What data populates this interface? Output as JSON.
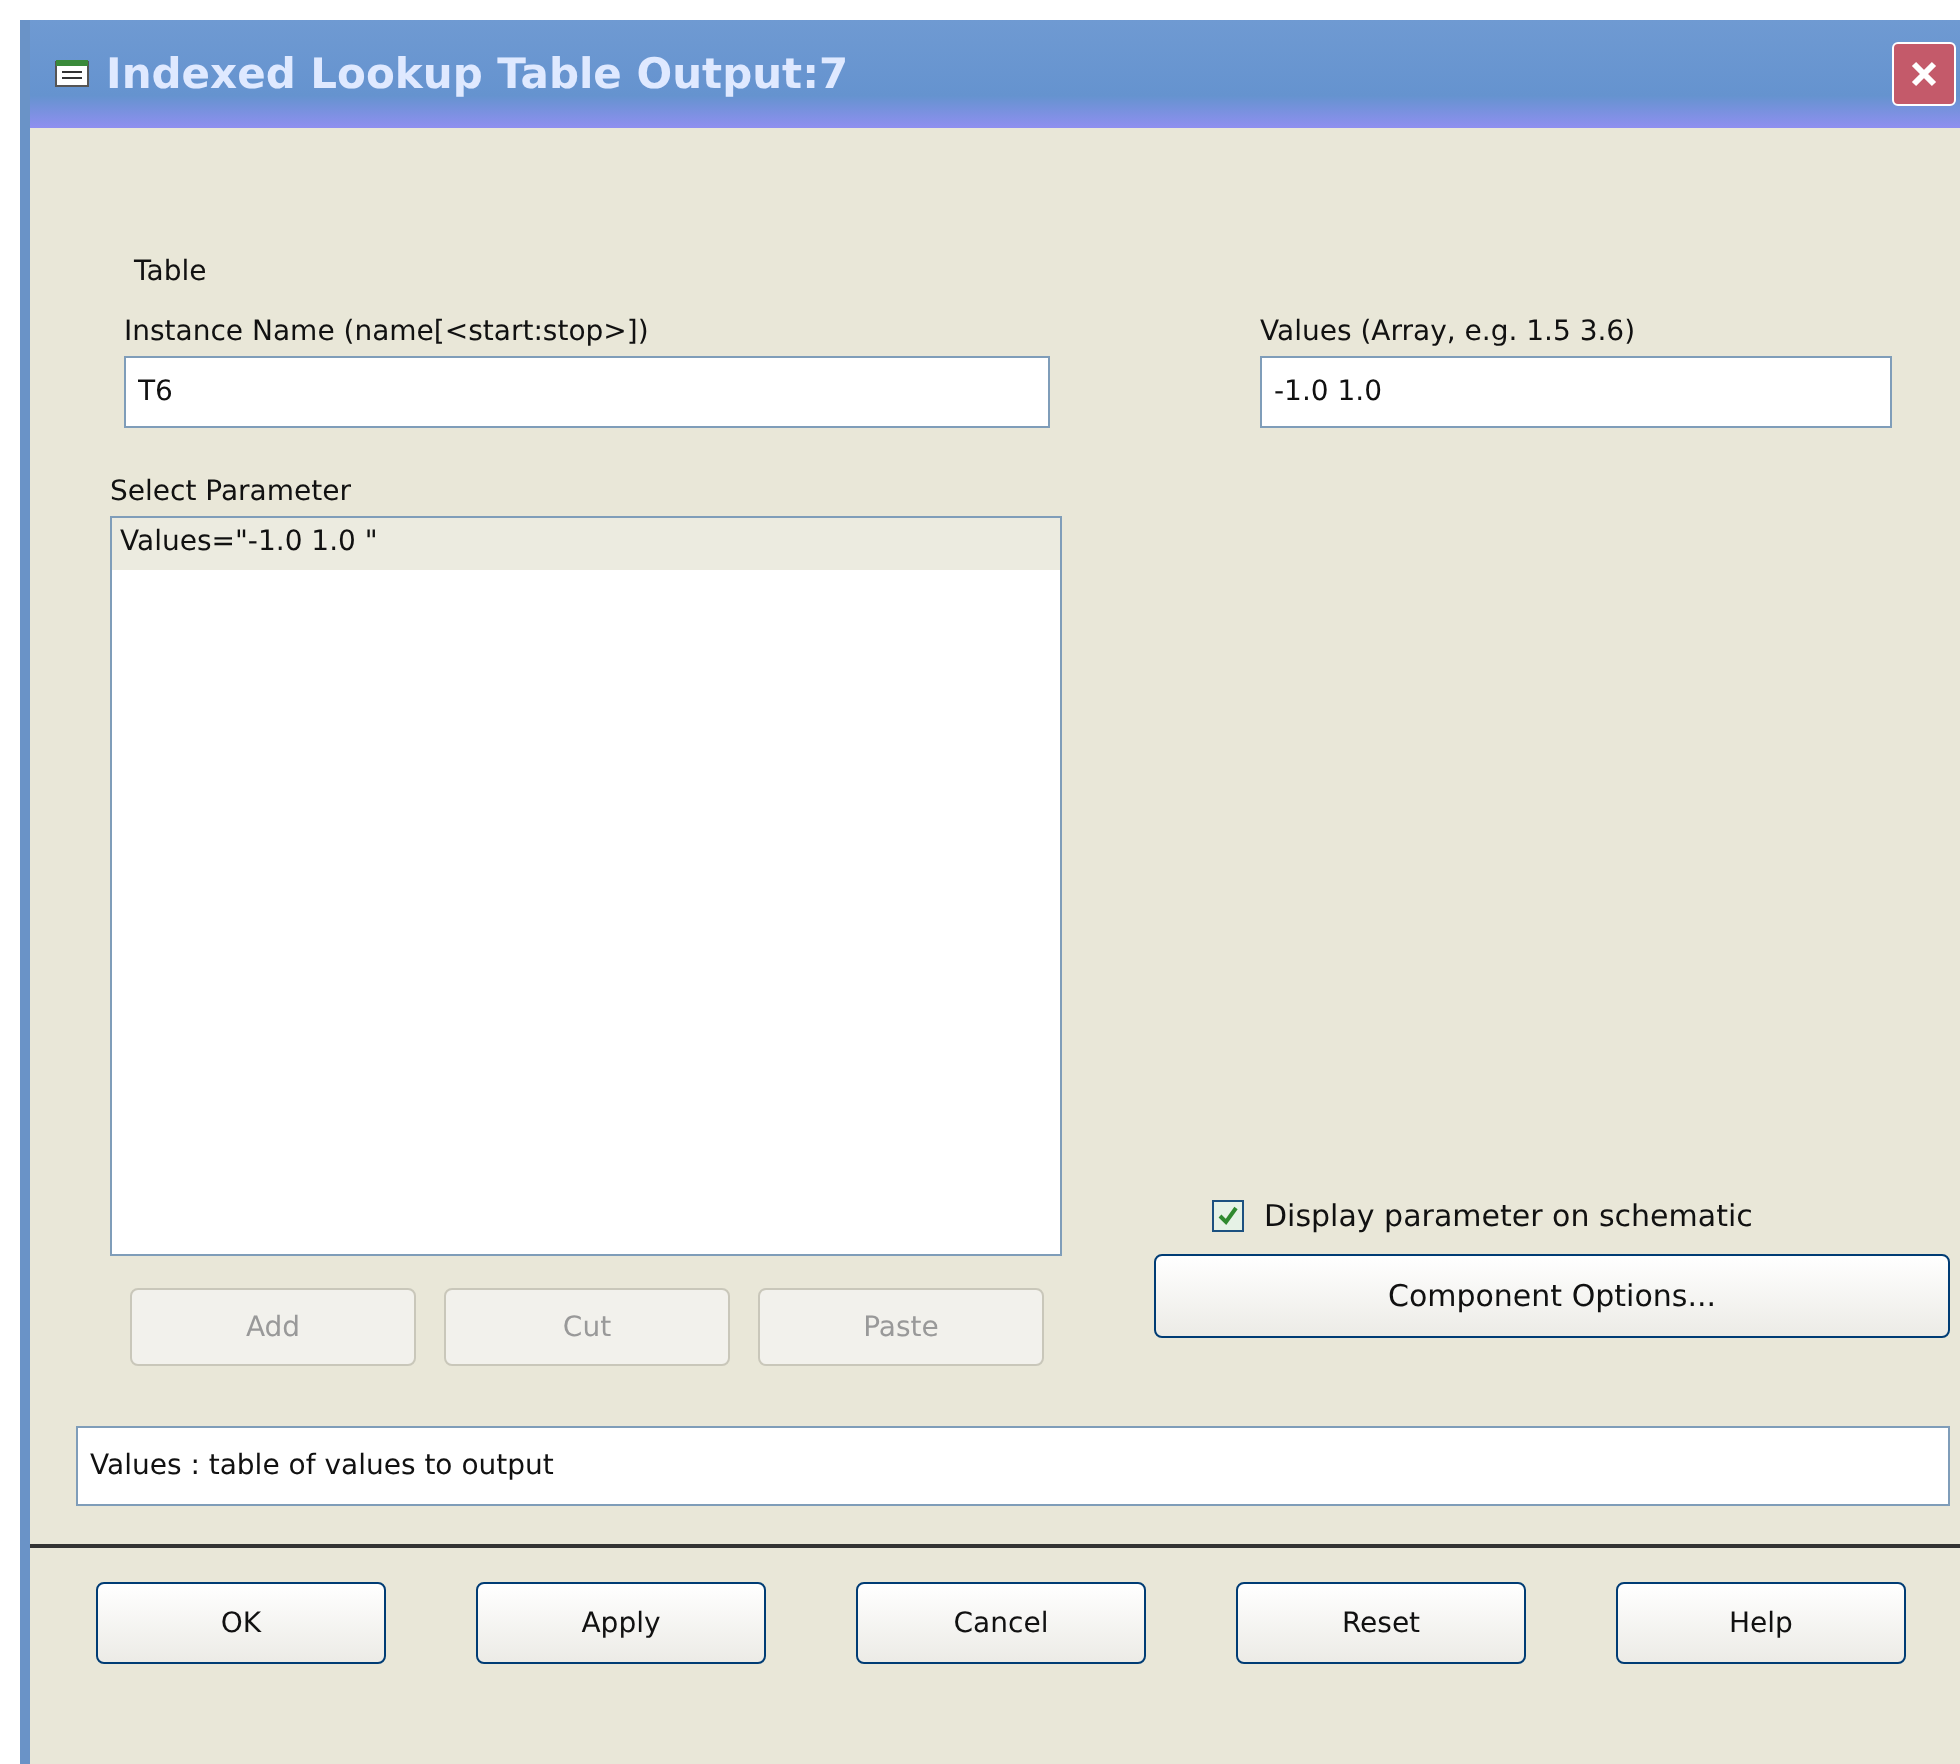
{
  "window": {
    "title": "Indexed Lookup Table Output:7"
  },
  "group_label": "Table",
  "instance_name": {
    "label": "Instance Name  (name[<start:stop>])",
    "value": "T6"
  },
  "values_field": {
    "label": "Values (Array, e.g. 1.5 3.6)",
    "value": "-1.0 1.0"
  },
  "parameters": {
    "label": "Select Parameter",
    "items": [
      {
        "text": "Values=\"-1.0 1.0 \"",
        "selected": true
      }
    ]
  },
  "list_buttons": [
    {
      "label": "Add",
      "disabled": true
    },
    {
      "label": "Cut",
      "disabled": true
    },
    {
      "label": "Paste",
      "disabled": true
    }
  ],
  "display_on_schematic": {
    "label": "Display parameter on schematic",
    "checked": true
  },
  "options_button": "Component Options...",
  "description": "Values : table of values to output",
  "buttons": [
    "OK",
    "Apply",
    "Cancel",
    "Reset",
    "Help"
  ]
}
